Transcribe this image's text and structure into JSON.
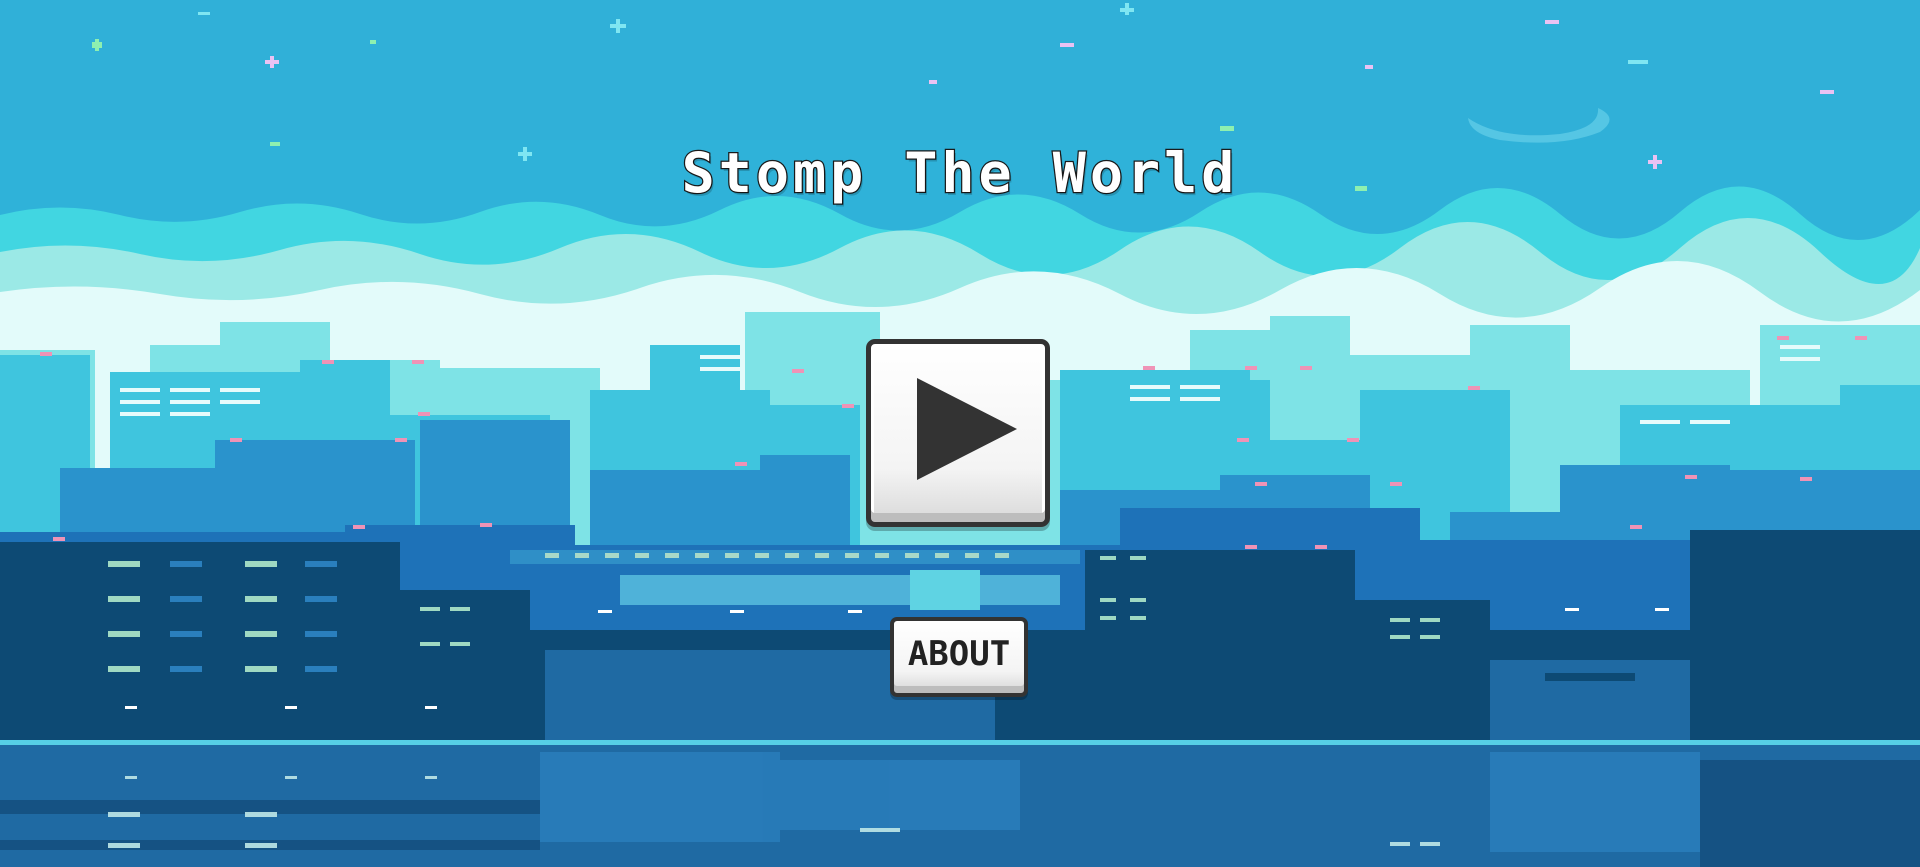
{
  "game": {
    "title": "Stomp The World"
  },
  "menu": {
    "play_icon": "play-icon",
    "about_label": "ABOUT"
  },
  "colors": {
    "sky": "#2fb2d9",
    "cloud_light": "#e3fbfa",
    "city_far": "#7ee3e6",
    "city_mid": "#3fc5de",
    "city_near": "#1e72b8",
    "city_front": "#0d4a74",
    "water": "#1f6aa3",
    "button_face": "#ffffff",
    "button_outline": "#333333"
  }
}
